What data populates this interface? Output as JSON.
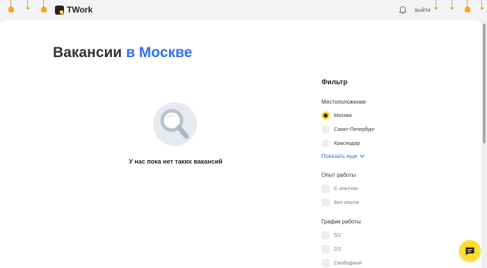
{
  "header": {
    "brand": "TWork",
    "logout_label": "выйти"
  },
  "colors": {
    "accent_blue": "#336fee",
    "brand_yellow": "#ffdd2d"
  },
  "page": {
    "title_prefix": "Вакансии",
    "title_city": "в Москве"
  },
  "empty_state": {
    "icon": "magnifier-icon",
    "message": "У нас пока нет таких вакансий"
  },
  "filter": {
    "title": "Фильтр",
    "location": {
      "title": "Местоположение",
      "options": [
        {
          "label": "Москва",
          "selected": true
        },
        {
          "label": "Санкт-Петербург",
          "selected": false
        },
        {
          "label": "Краснодар",
          "selected": false
        }
      ],
      "show_more": "Показать еще"
    },
    "experience": {
      "title": "Опыт работы",
      "options": [
        {
          "label": "С опытом"
        },
        {
          "label": "Без опыта"
        }
      ]
    },
    "schedule": {
      "title": "График работы",
      "options": [
        {
          "label": "5/2"
        },
        {
          "label": "2/2"
        },
        {
          "label": "Свободный"
        }
      ]
    }
  }
}
